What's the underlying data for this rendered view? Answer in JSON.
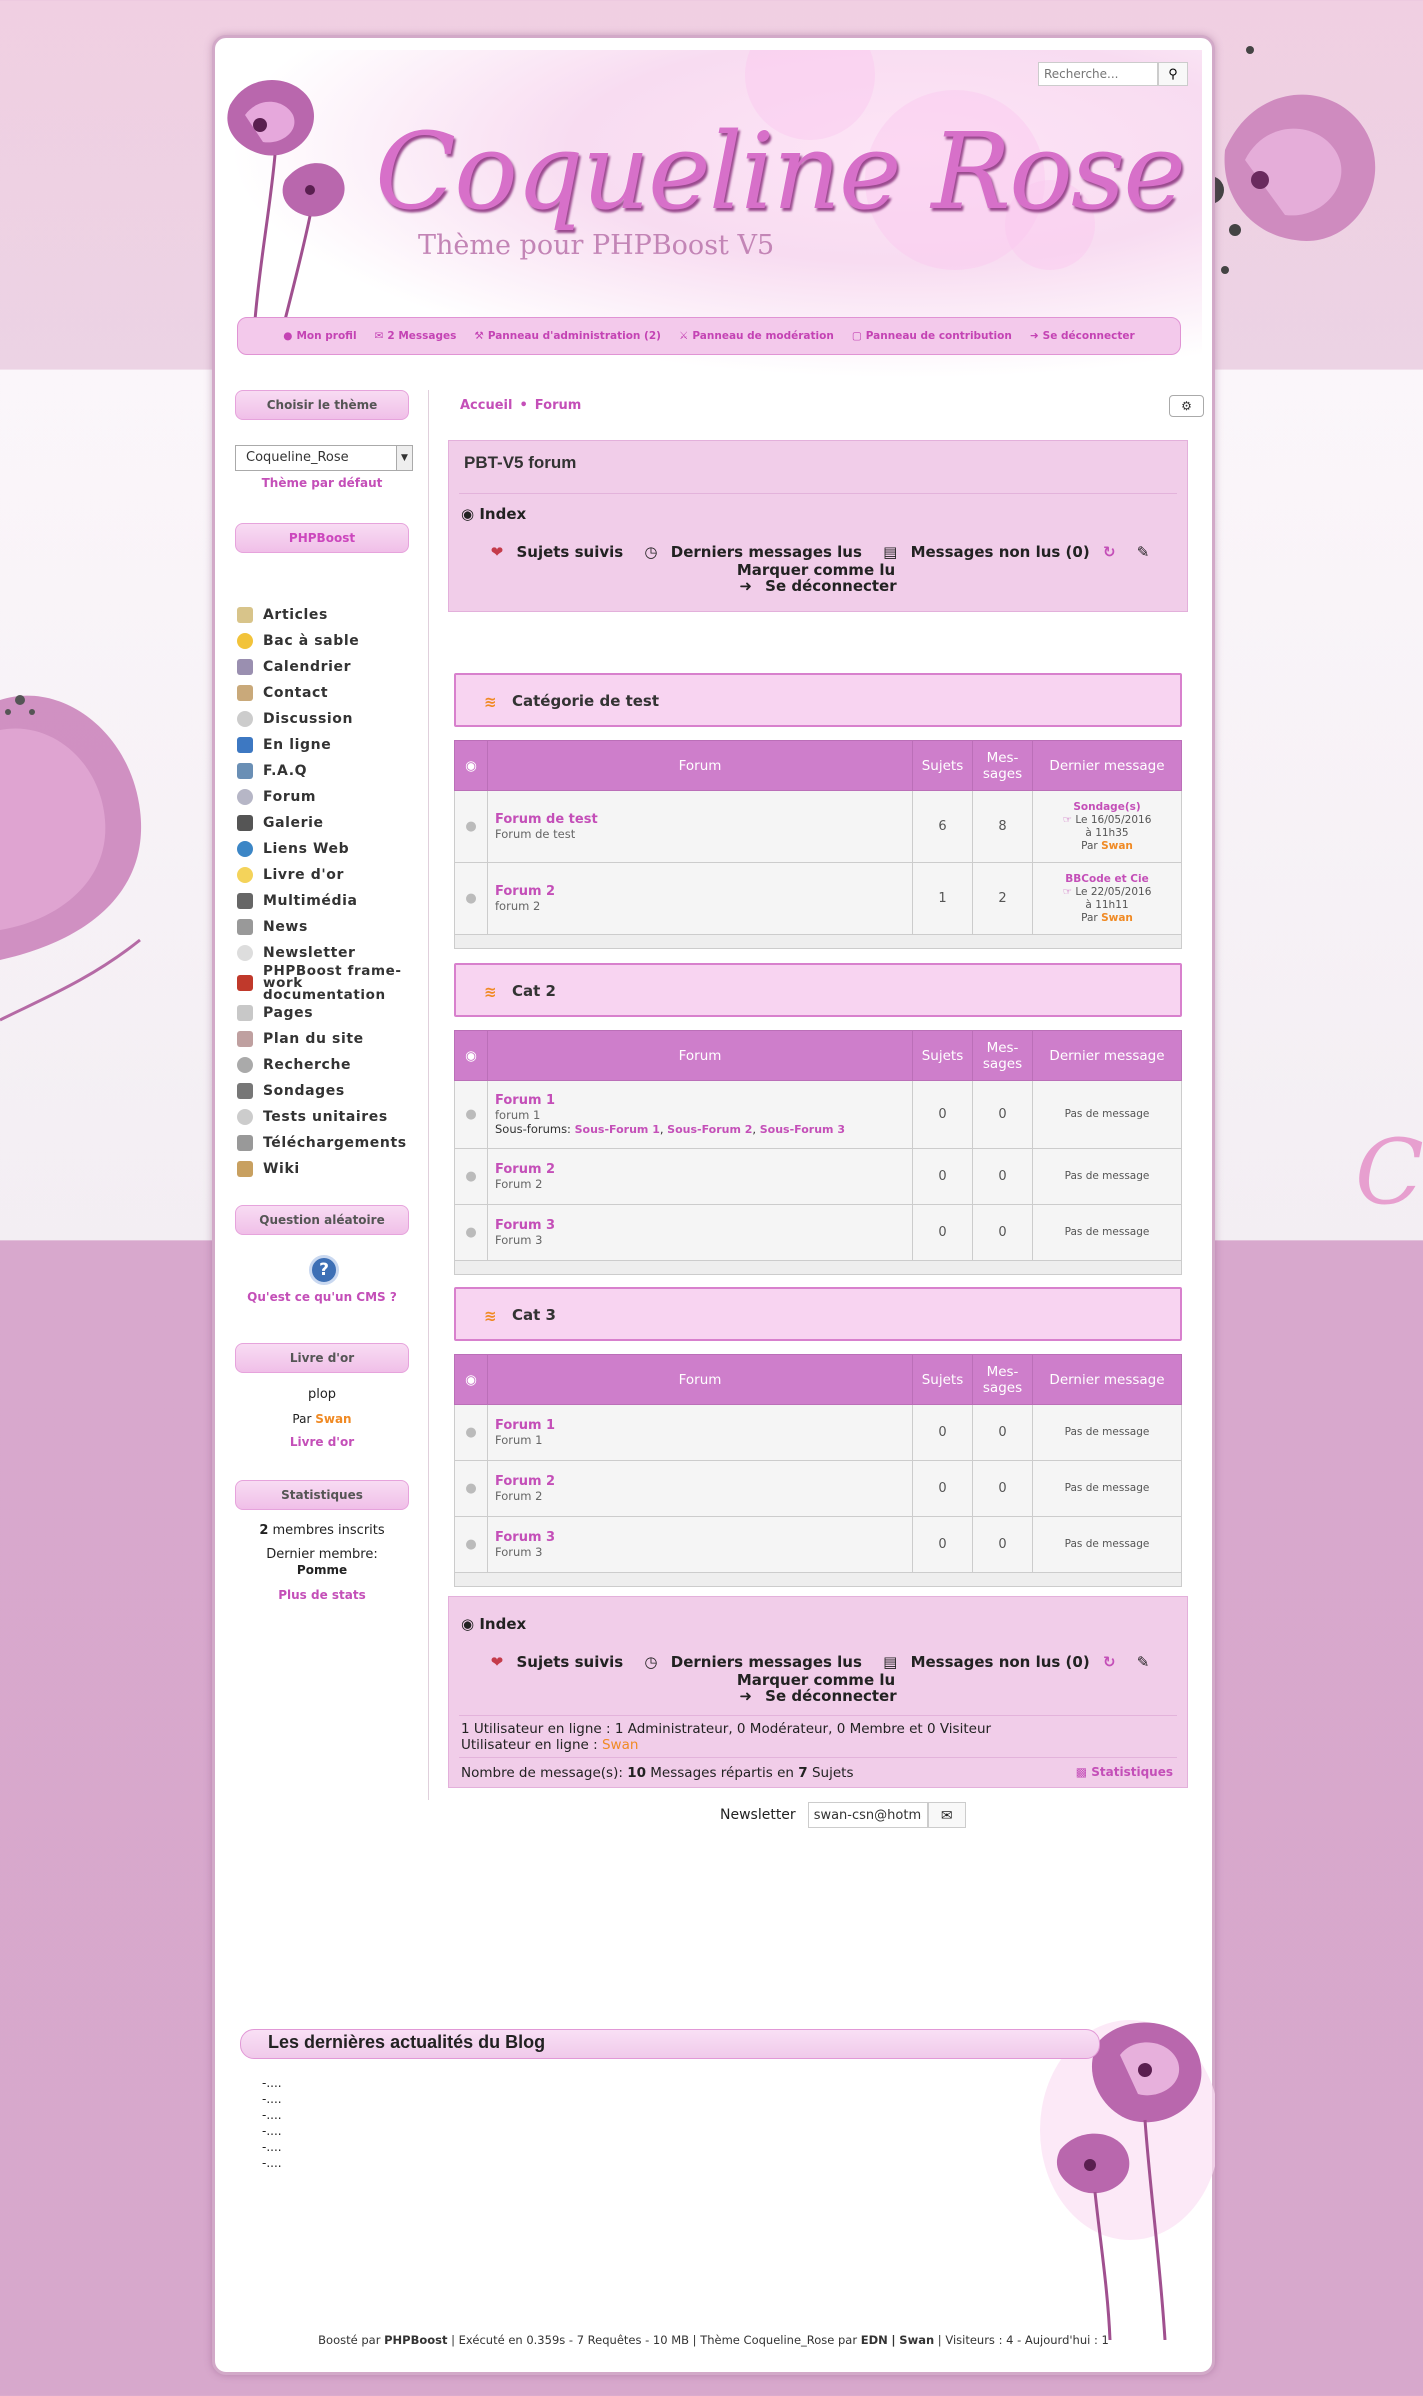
{
  "site": {
    "logo": "Coqueline Rose",
    "slogan": "Thème pour PHPBoost V5",
    "search_placeholder": "Recherche...",
    "search_icon": "search-icon"
  },
  "usermenu": [
    {
      "icon": "user-icon",
      "label": "Mon profil"
    },
    {
      "icon": "envelope-icon",
      "label": "2 Messages"
    },
    {
      "icon": "wrench-icon",
      "label": "Panneau d'administration (2)"
    },
    {
      "icon": "gavel-icon",
      "label": "Panneau de modération"
    },
    {
      "icon": "file-icon",
      "label": "Panneau de contribution"
    },
    {
      "icon": "signout-icon",
      "label": "Se déconnecter"
    }
  ],
  "left": {
    "theme_title": "Choisir le thème",
    "theme_select": "Coqueline_Rose",
    "theme_default": "Thème par défaut",
    "menu_title": "PHPBoost",
    "menu": [
      "Articles",
      "Bac à sable",
      "Calendrier",
      "Contact",
      "Discussion",
      "En ligne",
      "F.A.Q",
      "Forum",
      "Galerie",
      "Liens Web",
      "Livre d'or",
      "Multimédia",
      "News",
      "Newsletter",
      "PHPBoost frame-work documentation",
      "Pages",
      "Plan du site",
      "Recherche",
      "Sondages",
      "Tests unitaires",
      "Téléchargements",
      "Wiki"
    ],
    "question_title": "Question aléatoire",
    "question_text": "Qu'est ce qu'un CMS ?",
    "guestbook_title": "Livre d'or",
    "guestbook_msg": "plop",
    "guestbook_by": "Par",
    "guestbook_author": "Swan",
    "guestbook_link": "Livre d'or",
    "stats_title": "Statistiques",
    "stats_members_count": "2",
    "stats_members_text": "membres inscrits",
    "stats_last_label": "Dernier membre:",
    "stats_last_member": "Pomme",
    "stats_more": "Plus de stats"
  },
  "main": {
    "breadcrumb": [
      "Accueil",
      "Forum"
    ],
    "forum_title": "PBT-V5 forum",
    "index_label": "Index",
    "actions": {
      "followed": "Sujets suivis",
      "last_read": "Derniers messages lus",
      "unread": "Messages non lus (0)",
      "mark_read": "Marquer comme lu",
      "logout": "Se déconnecter"
    },
    "table_headers": {
      "forum": "Forum",
      "topics": "Sujets",
      "messages": "Mes-sages",
      "last": "Dernier message"
    },
    "categories": [
      {
        "name": "Catégorie de test",
        "forums": [
          {
            "name": "Forum de test",
            "desc": "Forum de test",
            "topics": "6",
            "messages": "8",
            "last_title": "Sondage(s)",
            "last_date": "Le 16/05/2016 à 11h35",
            "last_by": "Par",
            "last_user": "Swan"
          },
          {
            "name": "Forum 2",
            "desc": "forum 2",
            "topics": "1",
            "messages": "2",
            "last_title": "BBCode et Cie",
            "last_date": "Le 22/05/2016 à 11h11",
            "last_by": "Par",
            "last_user": "Swan"
          }
        ]
      },
      {
        "name": "Cat 2",
        "forums": [
          {
            "name": "Forum 1",
            "desc": "forum 1",
            "subforums_label": "Sous-forums:",
            "subforums": [
              "Sous-Forum 1",
              "Sous-Forum 2",
              "Sous-Forum 3"
            ],
            "topics": "0",
            "messages": "0",
            "last": "Pas de message"
          },
          {
            "name": "Forum 2",
            "desc": "Forum 2",
            "topics": "0",
            "messages": "0",
            "last": "Pas de message"
          },
          {
            "name": "Forum 3",
            "desc": "Forum 3",
            "topics": "0",
            "messages": "0",
            "last": "Pas de message"
          }
        ]
      },
      {
        "name": "Cat 3",
        "forums": [
          {
            "name": "Forum 1",
            "desc": "Forum 1",
            "topics": "0",
            "messages": "0",
            "last": "Pas de message"
          },
          {
            "name": "Forum 2",
            "desc": "Forum 2",
            "topics": "0",
            "messages": "0",
            "last": "Pas de message"
          },
          {
            "name": "Forum 3",
            "desc": "Forum 3",
            "topics": "0",
            "messages": "0",
            "last": "Pas de message"
          }
        ]
      }
    ],
    "online_line1": "1 Utilisateur en ligne : 1 Administrateur, 0 Modérateur, 0 Membre et 0 Visiteur",
    "online_line2_label": "Utilisateur en ligne :",
    "online_user": "Swan",
    "msg_count_label": "Nombre de message(s):",
    "msg_count": "10",
    "msg_count_mid": "Messages répartis en",
    "topic_count": "7",
    "topic_label": "Sujets",
    "stats_link": "Statistiques"
  },
  "newsletter": {
    "label": "Newsletter",
    "value": "swan-csn@hotma"
  },
  "blog": {
    "title": "Les dernières actualités du Blog",
    "items": [
      "-....",
      "-....",
      "-....",
      "-....",
      "-....",
      "-...."
    ]
  },
  "credits": {
    "boosted": "Boosté par",
    "phpboost": "PHPBoost",
    "exec": "| Exécuté en 0.359s - 7 Requêtes - 10 MB | Thème Coqueline_Rose par",
    "edn": "EDN",
    "sep": "|",
    "swan": "Swan",
    "visitors": "| Visiteurs : 4 - Aujourd'hui : 1"
  },
  "colors": {
    "accent": "#c44fb8",
    "header_row": "#ce7ecb",
    "box_bg": "#f1cde9",
    "orange": "#f08a24"
  }
}
